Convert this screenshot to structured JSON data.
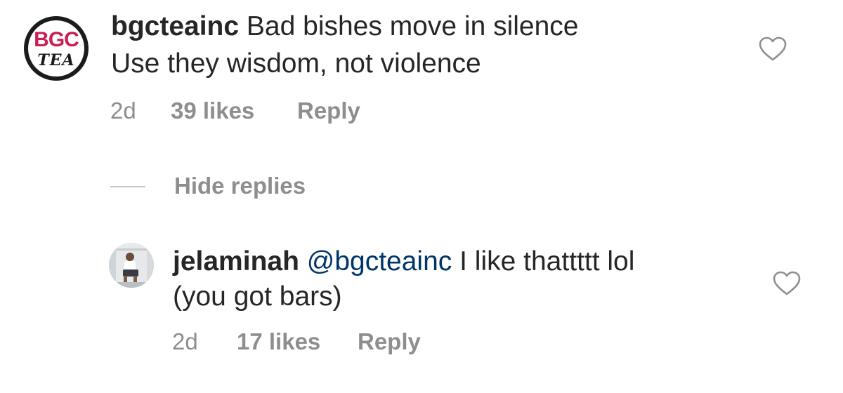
{
  "comments": [
    {
      "avatar_text_top": "BGC",
      "avatar_text_bottom": "TEA",
      "username": "bgcteainc",
      "line1": " Bad bishes move in silence",
      "line2": "Use they wisdom, not violence",
      "time": "2d",
      "likes": "39 likes",
      "reply_label": "Reply",
      "icon": "heart-outline-icon"
    }
  ],
  "hide_replies_label": "Hide replies",
  "replies": [
    {
      "username": "jelaminah",
      "mention": " @bgcteainc",
      "line1_rest": " I like thattttt lol",
      "line2": "(you got bars)",
      "time": "2d",
      "likes": "17 likes",
      "reply_label": "Reply",
      "icon": "heart-outline-icon"
    }
  ],
  "colors": {
    "text": "#262626",
    "meta": "#8e8e8e",
    "mention": "#003569",
    "brand_pink": "#c91f55"
  }
}
